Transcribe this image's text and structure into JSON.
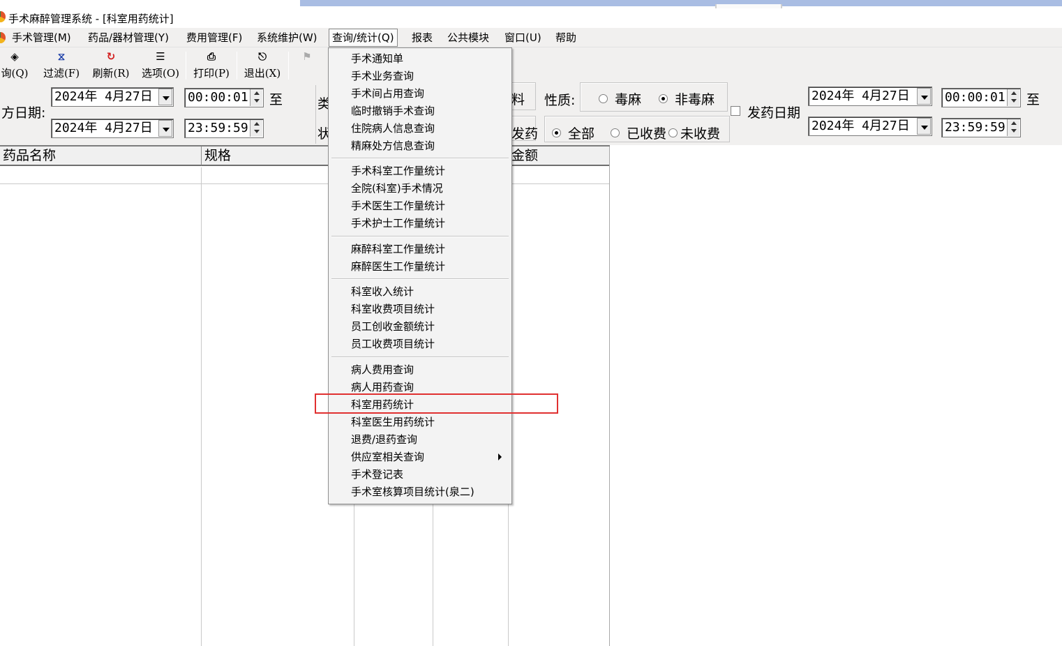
{
  "window": {
    "title": "手术麻醉管理系统 - [科室用药统计]"
  },
  "menubar": {
    "items": [
      {
        "label": "手术管理(M)"
      },
      {
        "label": "药品/器材管理(Y)"
      },
      {
        "label": "费用管理(F)"
      },
      {
        "label": "系统维护(W)"
      },
      {
        "label": "查询/统计(Q)"
      },
      {
        "label": "报表"
      },
      {
        "label": "公共模块"
      },
      {
        "label": "窗口(U)"
      },
      {
        "label": "帮助"
      }
    ]
  },
  "toolbar": {
    "query": "询(Q)",
    "filter": "过滤(F)",
    "refresh": "刷新(R)",
    "options": "选项(O)",
    "print": "打印(P)",
    "exit": "退出(X)"
  },
  "filter": {
    "rx_date_label": "方日期:",
    "date_from": "2024年  4月27日",
    "date_to": "2024年  4月27日",
    "time_from": "00:00:01",
    "time_to": "23:59:59",
    "to_label": "至",
    "type_label_1": "类",
    "type_label_2": "状",
    "material_label": "料",
    "dispense_label": "发药",
    "nature_label": "性质:",
    "nature_options": [
      "毒麻",
      "非毒麻"
    ],
    "charge_options": [
      "全部",
      "已收费",
      "未收费"
    ],
    "dispense_date_label": "发药日期",
    "right_date_from": "2024年  4月27日",
    "right_date_to": "2024年  4月27日",
    "right_time_from": "00:00:01",
    "right_time_to": "23:59:59",
    "right_to_label": "至"
  },
  "grid": {
    "columns": [
      "药品名称",
      "规格",
      "金额"
    ]
  },
  "dropdown": {
    "groups": [
      [
        "手术通知单",
        "手术业务查询",
        "手术间占用查询",
        "临时撤销手术查询",
        "住院病人信息查询",
        "精麻处方信息查询"
      ],
      [
        "手术科室工作量统计",
        "全院(科室)手术情况",
        "手术医生工作量统计",
        "手术护士工作量统计"
      ],
      [
        "麻醉科室工作量统计",
        "麻醉医生工作量统计"
      ],
      [
        "科室收入统计",
        "科室收费项目统计",
        "员工创收金额统计",
        "员工收费项目统计"
      ],
      [
        "病人费用查询",
        "病人用药查询",
        "科室用药统计",
        "科室医生用药统计",
        "退费/退药查询",
        "供应室相关查询",
        "手术登记表",
        "手术室核算项目统计(泉二)"
      ]
    ]
  },
  "colors": {
    "highlight": "#e03030",
    "chrome": "#f1f0ef"
  }
}
